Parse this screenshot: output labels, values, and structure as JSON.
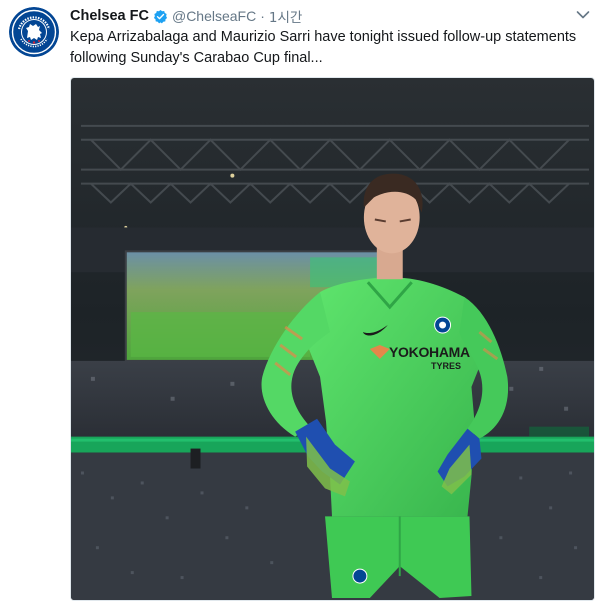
{
  "account": {
    "display_name": "Chelsea FC",
    "handle": "@ChelseaFC",
    "separator": "·",
    "time": "1시간",
    "verified": true,
    "avatar_icon": "chelsea-crest-icon"
  },
  "tweet": {
    "text": "Kepa Arrizabalaga and Maurizio Sarri have tonight issued follow-up statements following Sunday's Carabao Cup final..."
  },
  "media": {
    "shirt_sponsor": "YOKOHAMA",
    "shirt_sponsor_sub": "TYRES",
    "colors": {
      "kit_green": "#5ee06a",
      "kit_dark": "#2fa546",
      "glove_blue": "#1f4fb0",
      "stadium_dark": "#1b2126",
      "pitch_screen": "#4ea53c"
    }
  },
  "icons": {
    "verified": "verified-badge-icon",
    "caret": "chevron-down-icon"
  },
  "colors": {
    "text_primary": "#14171a",
    "text_secondary": "#657786",
    "verified_blue": "#1da1f2",
    "chelsea_blue": "#034694"
  }
}
